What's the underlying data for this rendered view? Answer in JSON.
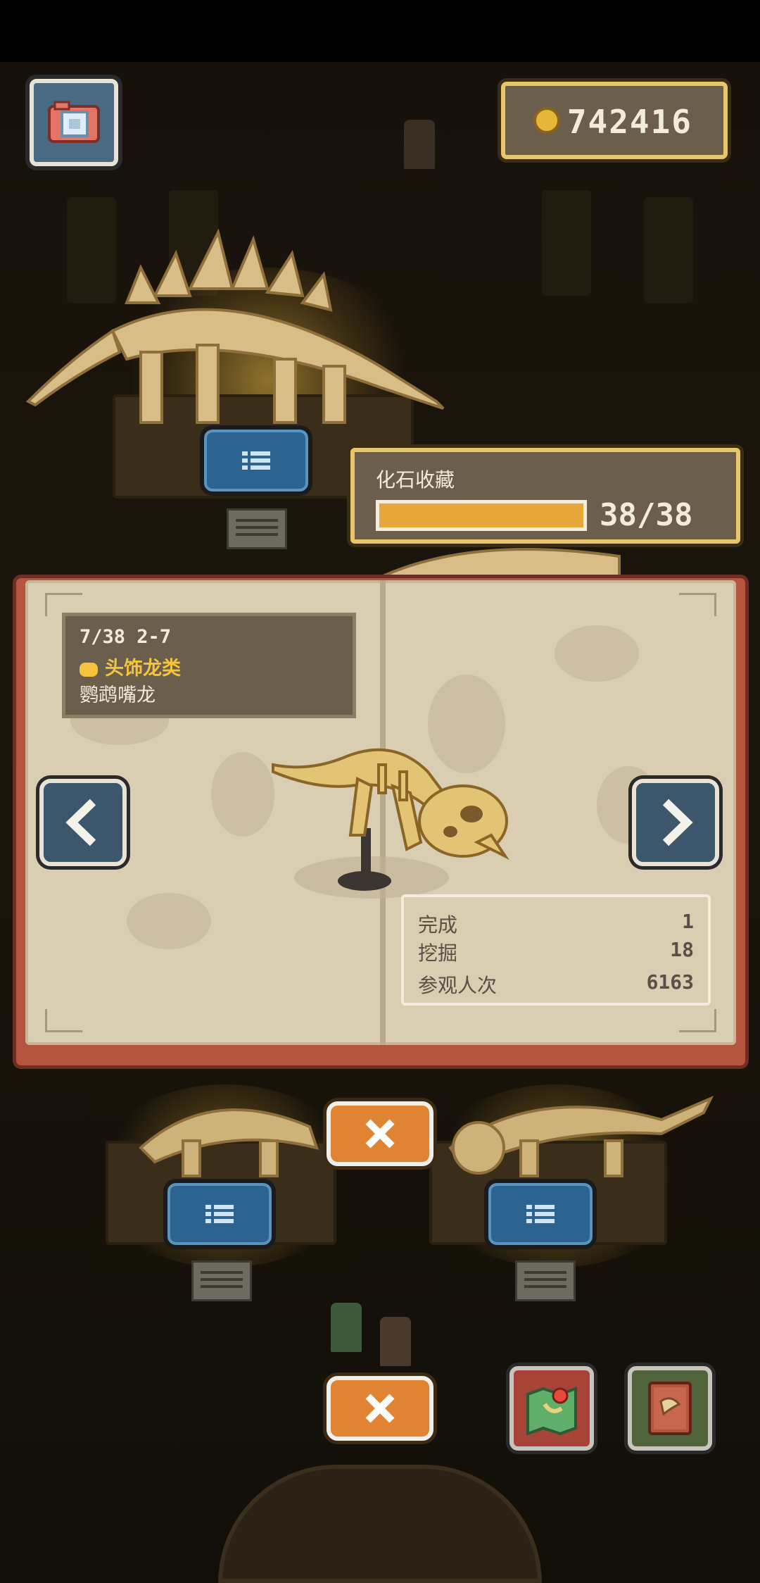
{
  "coins": {
    "value": "742416"
  },
  "collection": {
    "title": "化石收藏",
    "progress_text": "38/38",
    "progress_fraction": 1.0
  },
  "fossil": {
    "index_line": "7/38 2-7",
    "category": "头饰龙类",
    "name": "鹦鹉嘴龙"
  },
  "stats": [
    {
      "label": "完成",
      "value": "1"
    },
    {
      "label": "挖掘",
      "value": "18"
    },
    {
      "label": "参观人次",
      "value": "6163"
    }
  ],
  "icons": {
    "camera": "camera-icon",
    "coin": "coin-icon",
    "list": "list-icon",
    "prev": "chevron-left-icon",
    "next": "chevron-right-icon",
    "close": "close-icon",
    "map": "map-icon",
    "book": "book-icon"
  },
  "colors": {
    "panel": "#6b5e4c",
    "gold_border": "#e8c76a",
    "progress": "#e6a63a",
    "category": "#f4c53c",
    "list_button": "#2d6390",
    "close_button": "#e08434",
    "page": "#d9cdb2",
    "cover": "#b5553f"
  }
}
